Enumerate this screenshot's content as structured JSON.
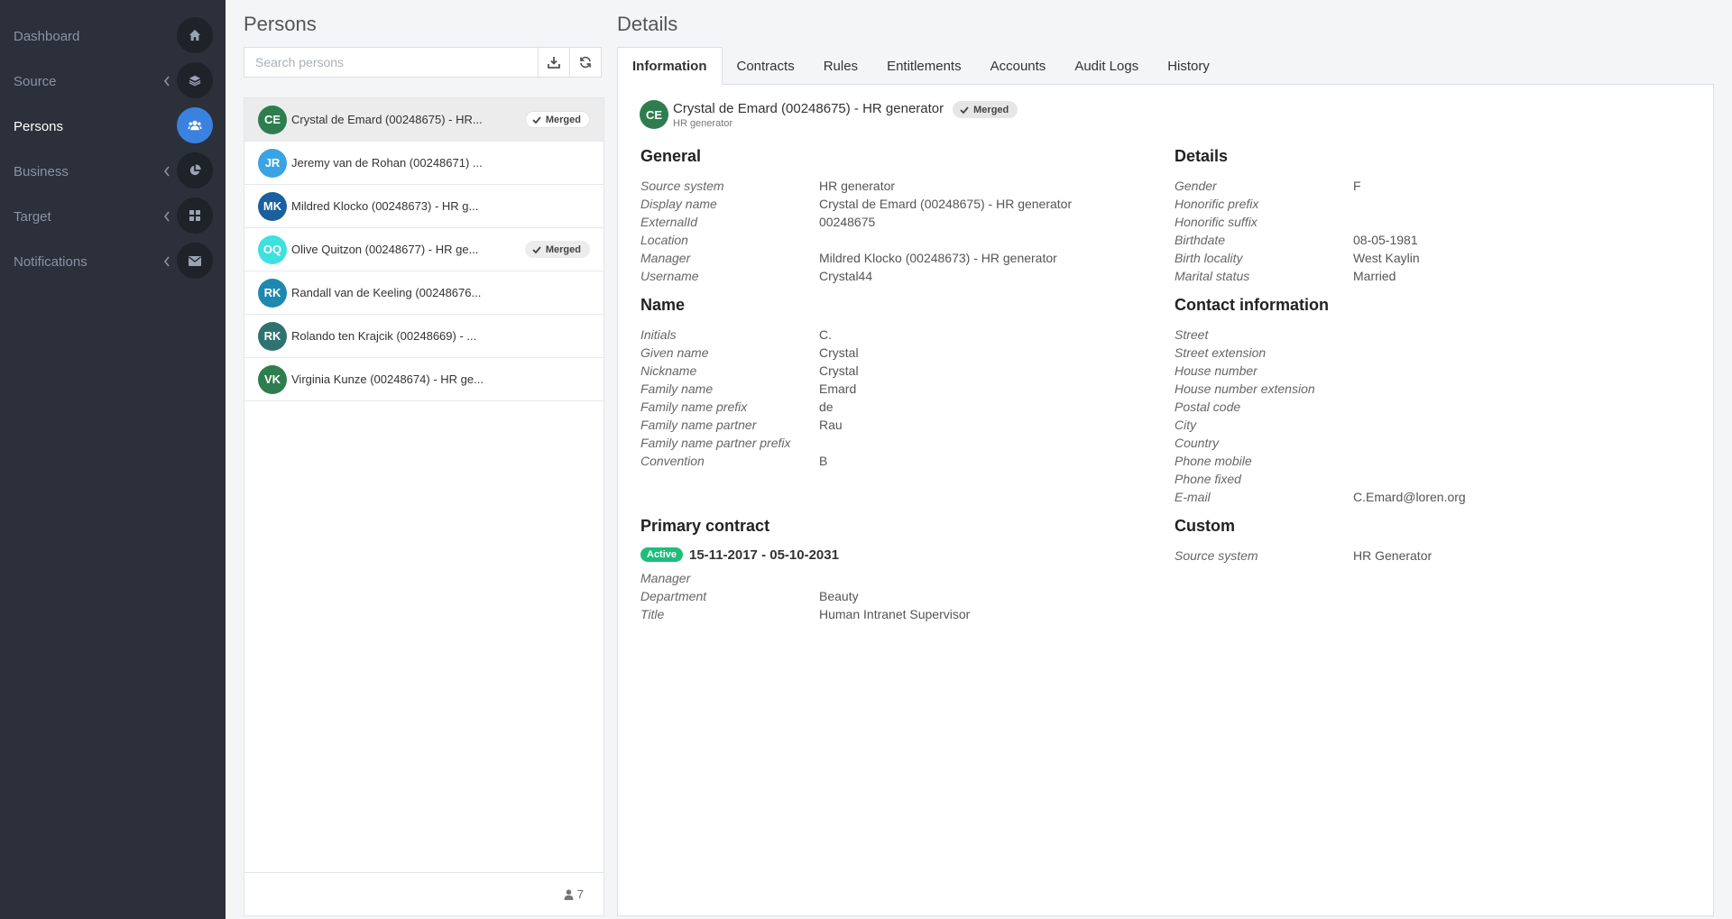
{
  "sidebar": {
    "items": [
      {
        "label": "Dashboard",
        "icon": "home-icon",
        "chevron": false,
        "active": false
      },
      {
        "label": "Source",
        "icon": "layers-icon",
        "chevron": true,
        "active": false
      },
      {
        "label": "Persons",
        "icon": "users-icon",
        "chevron": false,
        "active": true
      },
      {
        "label": "Business",
        "icon": "pie-chart-icon",
        "chevron": true,
        "active": false
      },
      {
        "label": "Target",
        "icon": "grid-icon",
        "chevron": true,
        "active": false
      },
      {
        "label": "Notifications",
        "icon": "envelope-icon",
        "chevron": true,
        "active": false
      }
    ]
  },
  "persons": {
    "title": "Persons",
    "search_placeholder": "Search persons",
    "count": "7",
    "rows": [
      {
        "initials": "CE",
        "name": "Crystal de Emard (00248675) - HR...",
        "color": "#2e7d4f",
        "merged": true,
        "selected": true
      },
      {
        "initials": "JR",
        "name": "Jeremy van de Rohan (00248671) ...",
        "color": "#3aa3e3",
        "merged": false,
        "selected": false
      },
      {
        "initials": "MK",
        "name": "Mildred Klocko (00248673) - HR g...",
        "color": "#1a5f9e",
        "merged": false,
        "selected": false
      },
      {
        "initials": "OQ",
        "name": "Olive Quitzon (00248677) - HR ge...",
        "color": "#3ee0e0",
        "merged": true,
        "selected": false
      },
      {
        "initials": "RK",
        "name": "Randall van de Keeling (00248676...",
        "color": "#1e88b0",
        "merged": false,
        "selected": false
      },
      {
        "initials": "RK",
        "name": "Rolando ten Krajcik (00248669) - ...",
        "color": "#2e7370",
        "merged": false,
        "selected": false
      },
      {
        "initials": "VK",
        "name": "Virginia Kunze (00248674) - HR ge...",
        "color": "#2e7d4f",
        "merged": false,
        "selected": false
      }
    ],
    "merged_label": "Merged"
  },
  "details": {
    "title": "Details",
    "tabs": [
      "Information",
      "Contracts",
      "Rules",
      "Entitlements",
      "Accounts",
      "Audit Logs",
      "History"
    ],
    "active_tab": 0,
    "header": {
      "initials": "CE",
      "name": "Crystal de Emard (00248675) - HR generator",
      "sub": "HR generator",
      "badge": "Merged"
    },
    "general": {
      "title": "General",
      "fields": [
        {
          "label": "Source system",
          "value": "HR generator"
        },
        {
          "label": "Display name",
          "value": "Crystal de Emard (00248675) - HR generator"
        },
        {
          "label": "ExternalId",
          "value": "00248675"
        },
        {
          "label": "Location",
          "value": ""
        },
        {
          "label": "Manager",
          "value": "Mildred Klocko (00248673) - HR generator"
        },
        {
          "label": "Username",
          "value": "Crystal44"
        }
      ]
    },
    "name": {
      "title": "Name",
      "fields": [
        {
          "label": "Initials",
          "value": "C."
        },
        {
          "label": "Given name",
          "value": "Crystal"
        },
        {
          "label": "Nickname",
          "value": "Crystal"
        },
        {
          "label": "Family name",
          "value": "Emard"
        },
        {
          "label": "Family name prefix",
          "value": "de"
        },
        {
          "label": "Family name partner",
          "value": "Rau"
        },
        {
          "label": "Family name partner prefix",
          "value": ""
        },
        {
          "label": "Convention",
          "value": "B"
        }
      ]
    },
    "primary_contract": {
      "title": "Primary contract",
      "status": "Active",
      "dates": "15-11-2017 - 05-10-2031",
      "fields": [
        {
          "label": "Manager",
          "value": ""
        },
        {
          "label": "Department",
          "value": "Beauty"
        },
        {
          "label": "Title",
          "value": "Human Intranet Supervisor"
        }
      ]
    },
    "details_section": {
      "title": "Details",
      "fields": [
        {
          "label": "Gender",
          "value": "F"
        },
        {
          "label": "Honorific prefix",
          "value": ""
        },
        {
          "label": "Honorific suffix",
          "value": ""
        },
        {
          "label": "Birthdate",
          "value": "08-05-1981"
        },
        {
          "label": "Birth locality",
          "value": "West Kaylin"
        },
        {
          "label": "Marital status",
          "value": "Married"
        }
      ]
    },
    "contact": {
      "title": "Contact information",
      "fields": [
        {
          "label": "Street",
          "value": ""
        },
        {
          "label": "Street extension",
          "value": ""
        },
        {
          "label": "House number",
          "value": ""
        },
        {
          "label": "House number extension",
          "value": ""
        },
        {
          "label": "Postal code",
          "value": ""
        },
        {
          "label": "City",
          "value": ""
        },
        {
          "label": "Country",
          "value": ""
        },
        {
          "label": "Phone mobile",
          "value": ""
        },
        {
          "label": "Phone fixed",
          "value": ""
        },
        {
          "label": "E-mail",
          "value": "C.Emard@loren.org"
        }
      ]
    },
    "custom": {
      "title": "Custom",
      "fields": [
        {
          "label": "Source system",
          "value": "HR Generator"
        }
      ]
    }
  }
}
